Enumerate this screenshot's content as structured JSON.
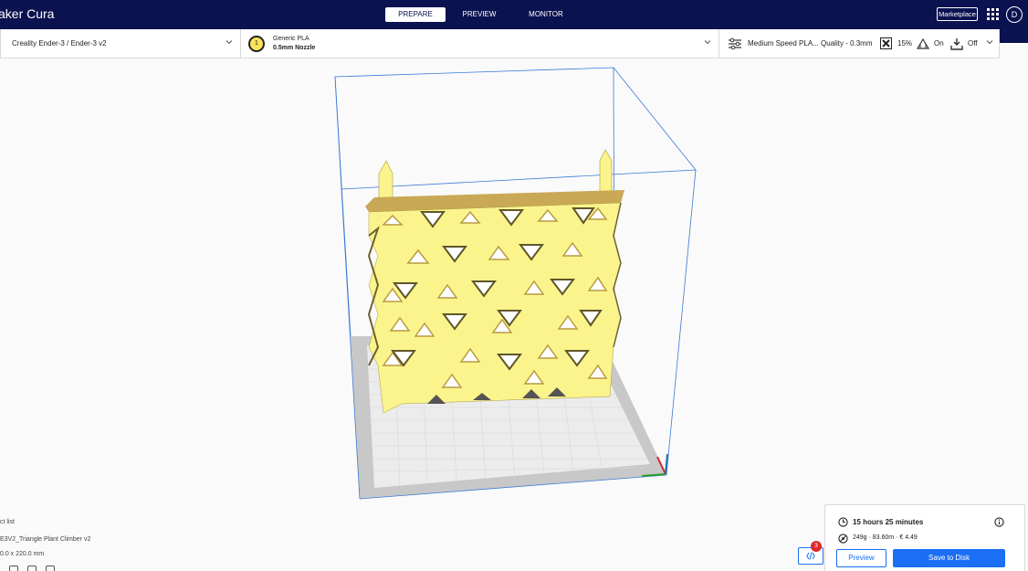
{
  "app": {
    "title": "aker Cura"
  },
  "stages": [
    {
      "label": "PREPARE",
      "active": true
    },
    {
      "label": "PREVIEW",
      "active": false
    },
    {
      "label": "MONITOR",
      "active": false
    }
  ],
  "header": {
    "marketplace_label": "Marketplace",
    "account_initial": "D"
  },
  "printer": {
    "name": "Creality Ender-3 / Ender-3 v2"
  },
  "extruder": {
    "index": "1",
    "material": "Generic PLA",
    "nozzle": "0.5mm Nozzle",
    "color": "#f9e45b"
  },
  "print_setup": {
    "profile": "Medium Speed PLA... Quality - 0.3mm",
    "infill": "15%",
    "support": "On",
    "adhesion": "Off"
  },
  "object_list": {
    "title": "ct list",
    "item": "E3V2_Triangle Plant Climber v2",
    "dimensions": "0.0 x 220.0 mm"
  },
  "messages": {
    "count": "3",
    "icon": "code-icon"
  },
  "print_info": {
    "time": "15 hours 25 minutes",
    "material_estimate": "249g · 83.60m · € 4.49",
    "preview_label": "Preview",
    "save_label": "Save to Disk"
  },
  "colors": {
    "header": "#0b1250",
    "accent": "#1b6ff5",
    "model": "#fbf48c",
    "badge": "#e0282b"
  }
}
